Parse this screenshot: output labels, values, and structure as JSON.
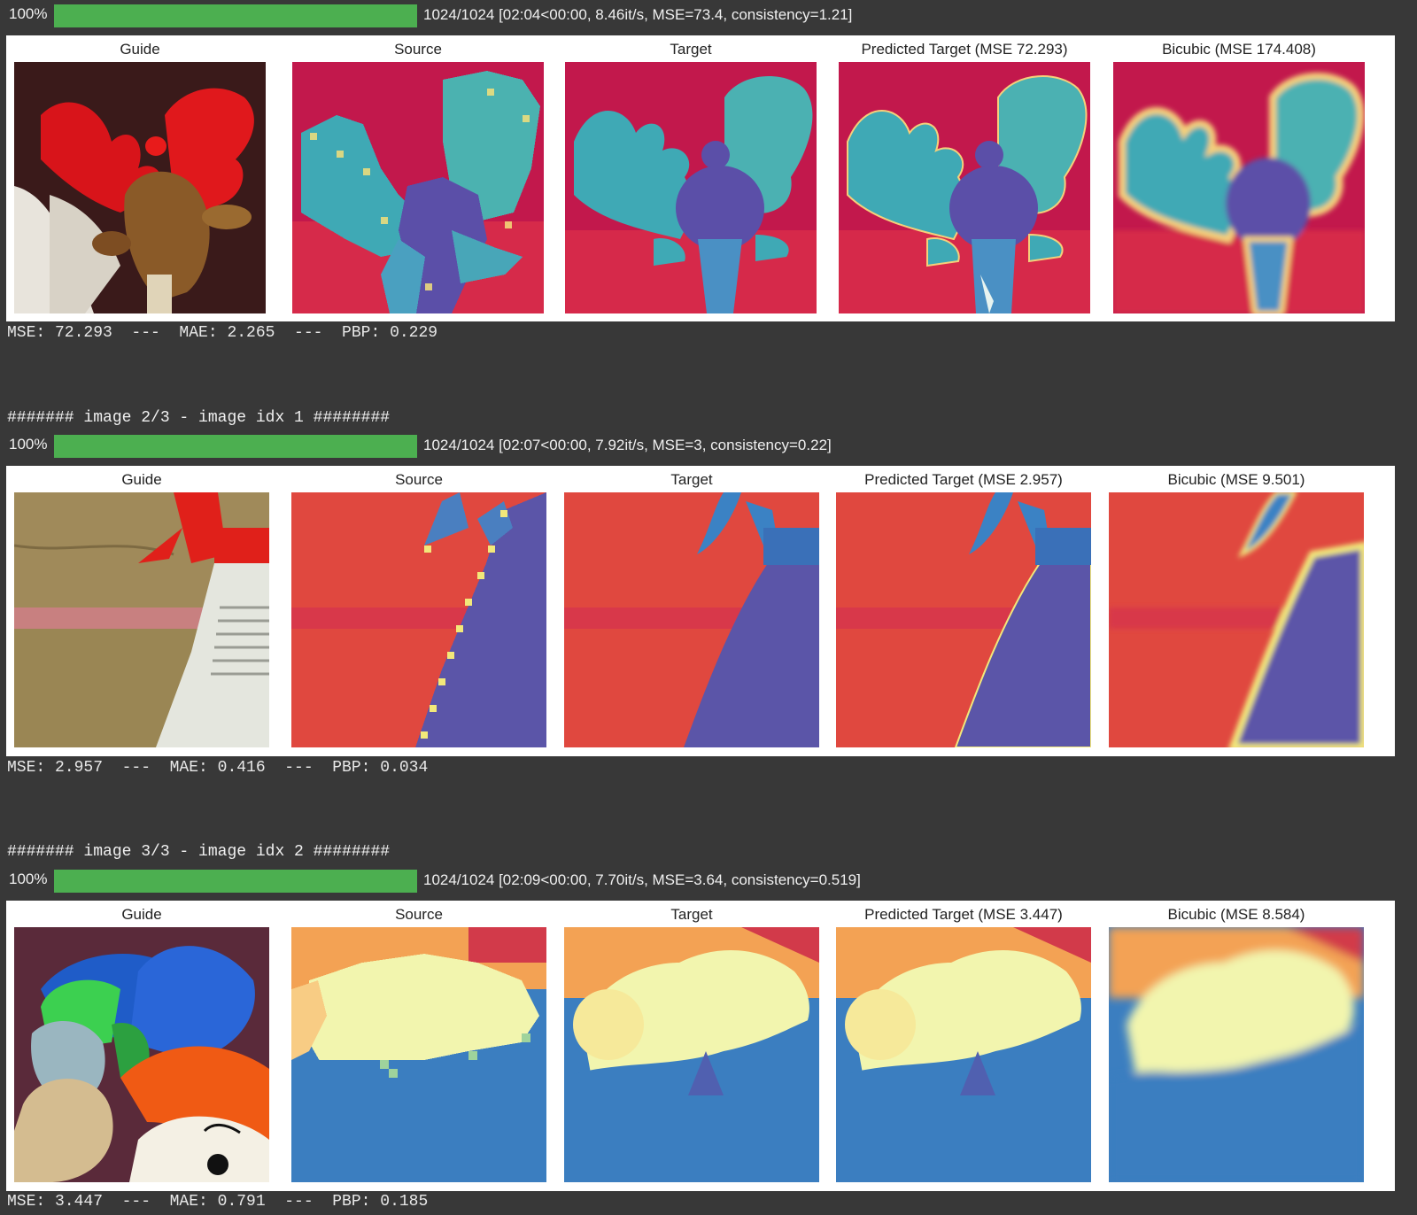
{
  "runs": [
    {
      "header": "",
      "progress": {
        "percent_label": "100%",
        "fraction": 1.0,
        "status": "1024/1024 [02:04<00:00, 8.46it/s, MSE=73.4, consistency=1.21]"
      },
      "titles": {
        "guide": "Guide",
        "source": "Source",
        "target": "Target",
        "predicted": "Predicted Target (MSE 72.293)",
        "bicubic": "Bicubic (MSE 174.408)"
      },
      "metrics": "MSE: 72.293  ---  MAE: 2.265  ---  PBP: 0.229"
    },
    {
      "header": "####### image 2/3 - image idx 1 ########",
      "progress": {
        "percent_label": "100%",
        "fraction": 1.0,
        "status": "1024/1024 [02:07<00:00, 7.92it/s, MSE=3, consistency=0.22]"
      },
      "titles": {
        "guide": "Guide",
        "source": "Source",
        "target": "Target",
        "predicted": "Predicted Target (MSE 2.957)",
        "bicubic": "Bicubic (MSE 9.501)"
      },
      "metrics": "MSE: 2.957  ---  MAE: 0.416  ---  PBP: 0.034"
    },
    {
      "header": "####### image 3/3 - image idx 2 ########",
      "progress": {
        "percent_label": "100%",
        "fraction": 1.0,
        "status": "1024/1024 [02:09<00:00, 7.70it/s, MSE=3.64, consistency=0.519]"
      },
      "titles": {
        "guide": "Guide",
        "source": "Source",
        "target": "Target",
        "predicted": "Predicted Target (MSE 3.447)",
        "bicubic": "Bicubic (MSE 8.584)"
      },
      "metrics": "MSE: 3.447  ---  MAE: 0.791  ---  PBP: 0.185"
    }
  ],
  "colors": {
    "progress_fill": "#4caf50",
    "depth_far": "#c2184c",
    "depth_mid": "#3fa9b5",
    "depth_near": "#5b4fa8",
    "depth_warm": "#e0483f",
    "depth_blue": "#3b82c4",
    "depth_light": "#f2f5ae"
  }
}
